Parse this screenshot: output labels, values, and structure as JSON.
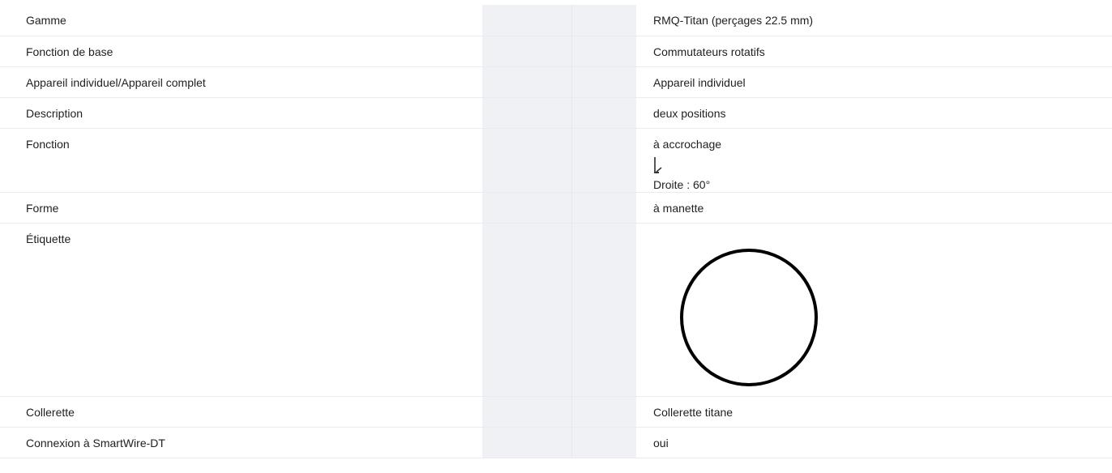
{
  "rows": [
    {
      "label": "Gamme",
      "value": "RMQ-Titan (perçages 22.5 mm)"
    },
    {
      "label": "Fonction de base",
      "value": "Commutateurs rotatifs"
    },
    {
      "label": "Appareil individuel/Appareil complet",
      "value": "Appareil individuel"
    },
    {
      "label": "Description",
      "value": "deux positions"
    },
    {
      "label": "Fonction",
      "value": "à accrochage",
      "icon": "rotation-symbol-icon",
      "value2": "Droite : 60°"
    },
    {
      "label": "Forme",
      "value": "à manette"
    },
    {
      "label": "Étiquette",
      "icon": "blank-circle-label-icon"
    },
    {
      "label": "Collerette",
      "value": "Collerette titane"
    },
    {
      "label": "Connexion à SmartWire-DT",
      "value": "oui"
    }
  ]
}
